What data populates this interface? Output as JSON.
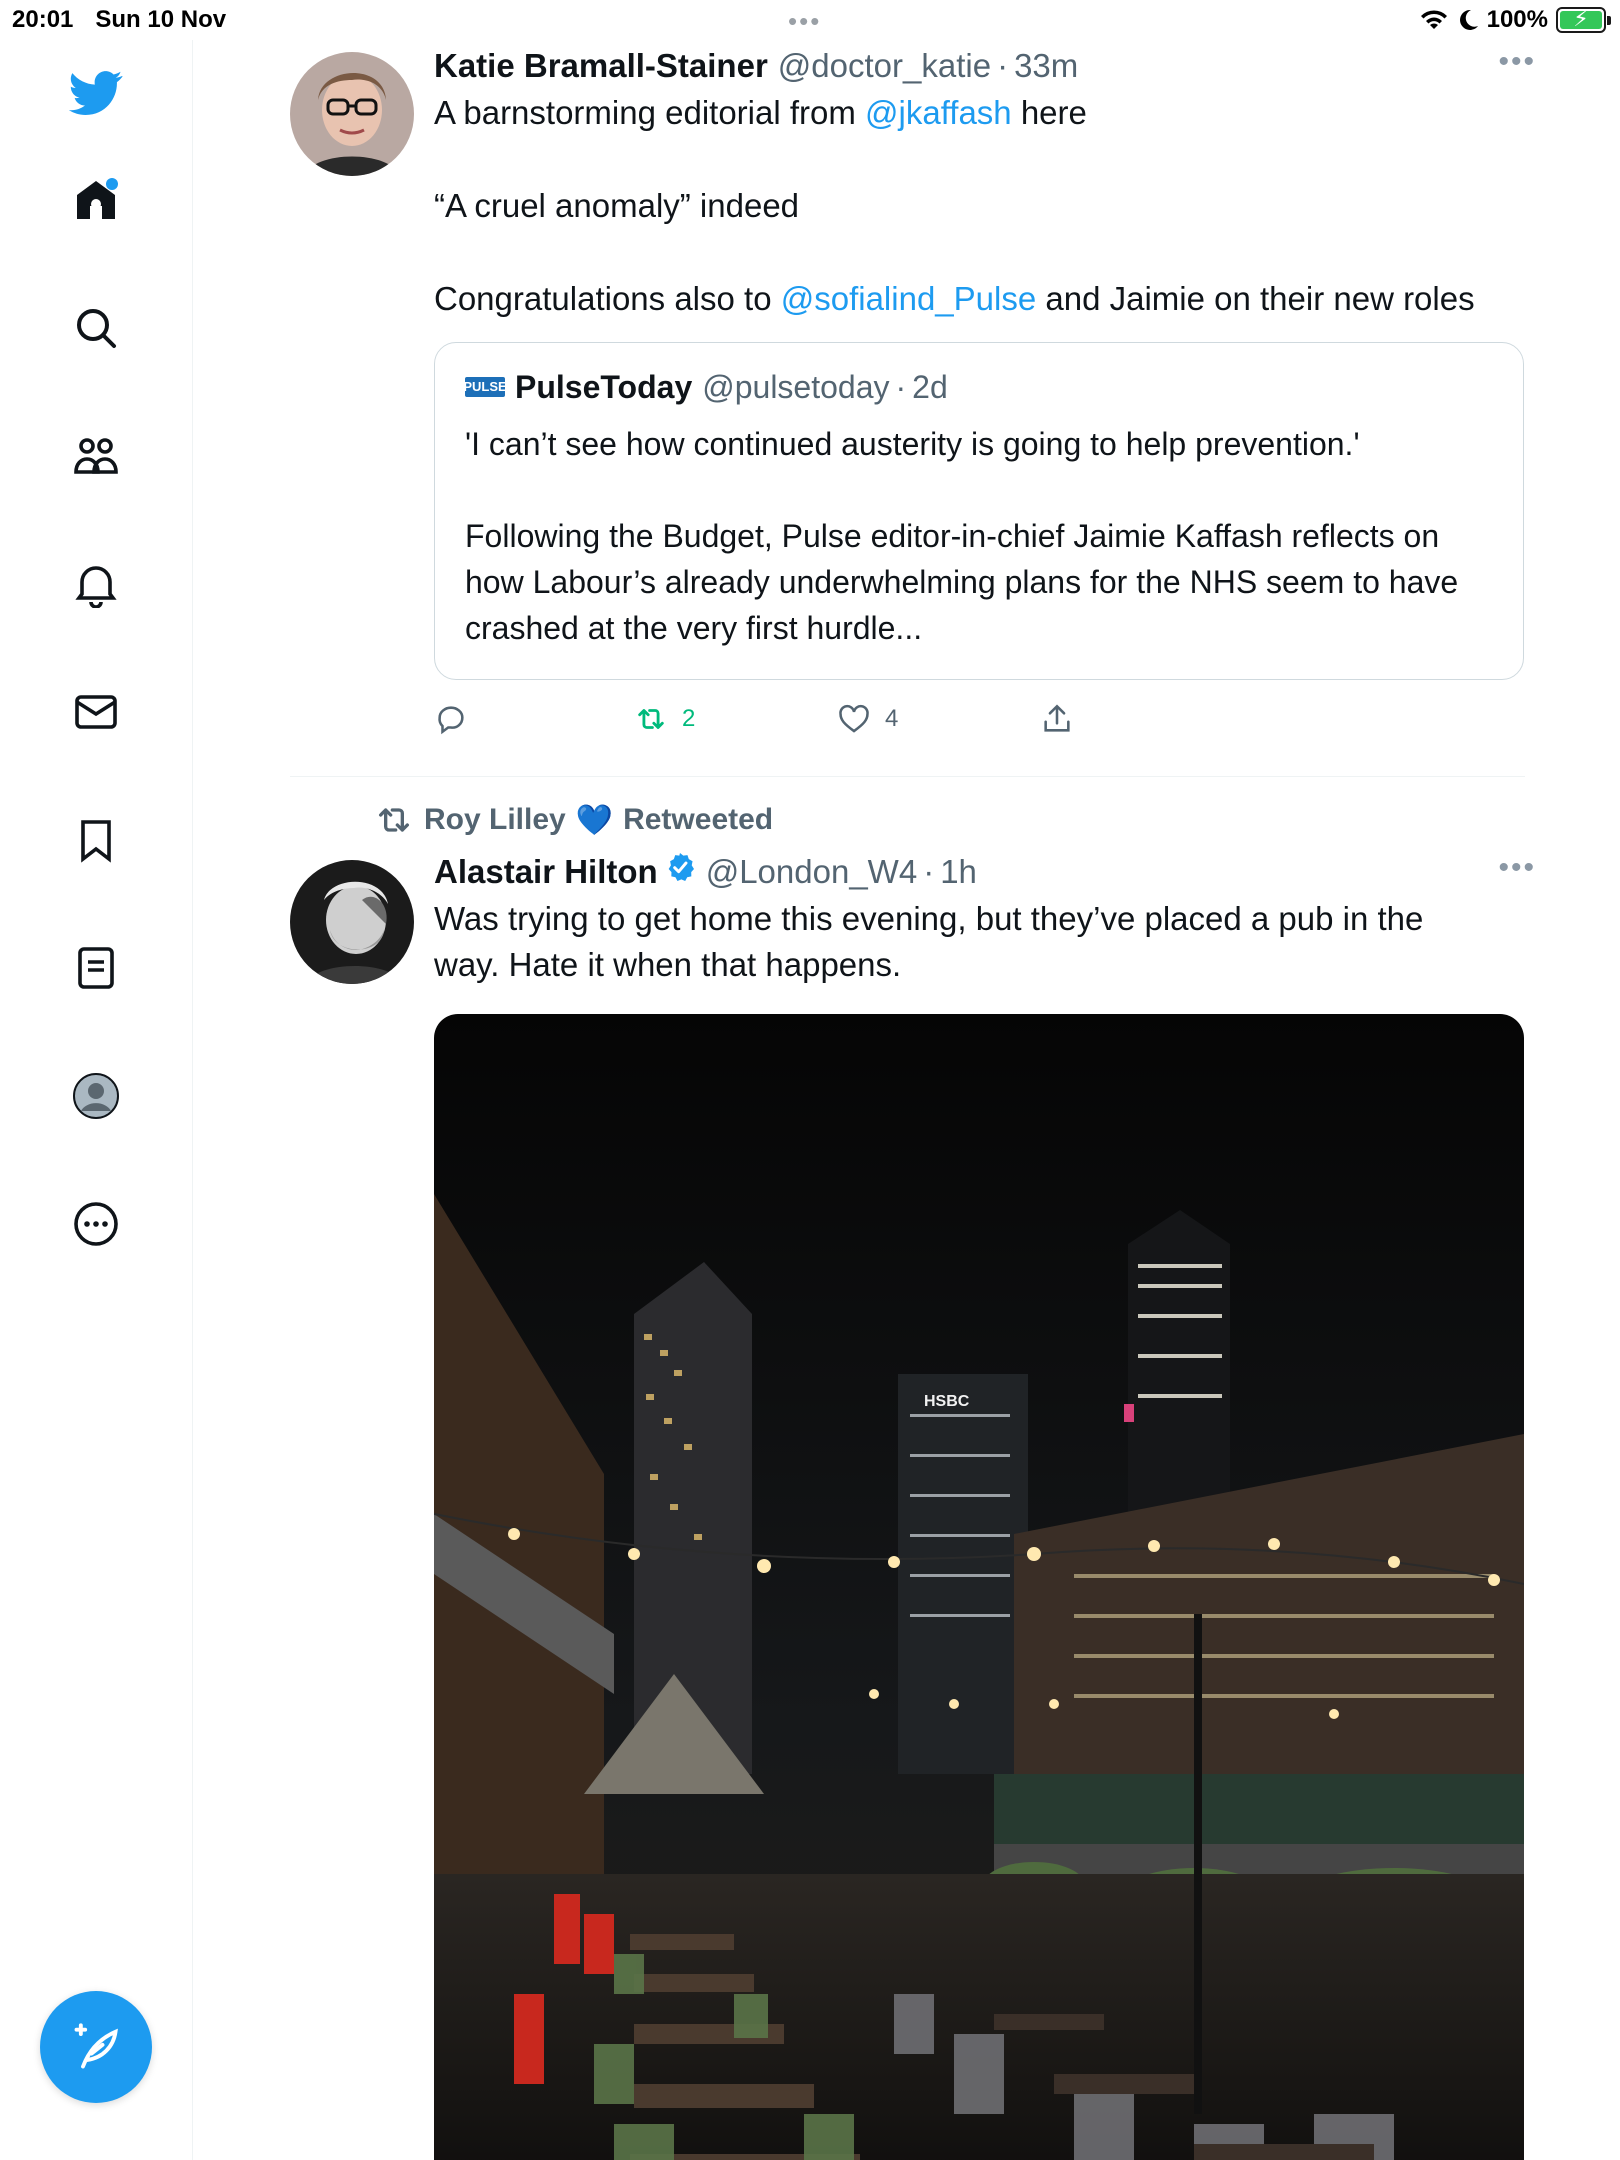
{
  "status_bar": {
    "time": "20:01",
    "date": "Sun 10 Nov",
    "battery_percent": "100%",
    "battery_level": 1.0
  },
  "sidebar": {
    "items": [
      {
        "name": "home-icon"
      },
      {
        "name": "search-icon"
      },
      {
        "name": "communities-icon"
      },
      {
        "name": "notifications-icon"
      },
      {
        "name": "messages-icon"
      },
      {
        "name": "bookmarks-icon"
      },
      {
        "name": "lists-icon"
      },
      {
        "name": "profile-icon"
      },
      {
        "name": "more-icon"
      }
    ],
    "accent": "#1d9bf0"
  },
  "tweet1": {
    "name": "Katie Bramall-Stainer",
    "handle": "@doctor_katie",
    "sep": "·",
    "time": "33m",
    "line1_pre": "A barnstorming editorial from ",
    "line1_mention": "@jkaffash",
    "line1_post": " here",
    "line2": "“A cruel anomaly” indeed",
    "line3_pre": "Congratulations also to ",
    "line3_mention": "@sofialind_Pulse",
    "line3_post": " and Jaimie on their new roles",
    "quote": {
      "logo": "PULSE",
      "name": "PulseToday",
      "handle": "@pulsetoday",
      "sep": "·",
      "time": "2d",
      "text1": "'I can’t see how continued austerity is going to help prevention.'",
      "text2": "Following the Budget, Pulse editor-in-chief Jaimie Kaffash reflects on how Labour’s already underwhelming plans for the NHS seem to have crashed at the very first hurdle..."
    },
    "retweets": "2",
    "likes": "4"
  },
  "tweet2": {
    "retweeted_by": "Roy Lilley",
    "retweeted_emoji": "💙",
    "retweeted_label": "Retweeted",
    "name": "Alastair Hilton",
    "handle": "@London_W4",
    "sep": "·",
    "time": "1h",
    "text": "Was trying to get home this evening, but they’ve placed a pub in the way. Hate it when that happens.",
    "photo_logo": "HSBC"
  },
  "colors": {
    "accent": "#1d9bf0",
    "retweet_green": "#00ba7c",
    "secondary_text": "#536471"
  }
}
